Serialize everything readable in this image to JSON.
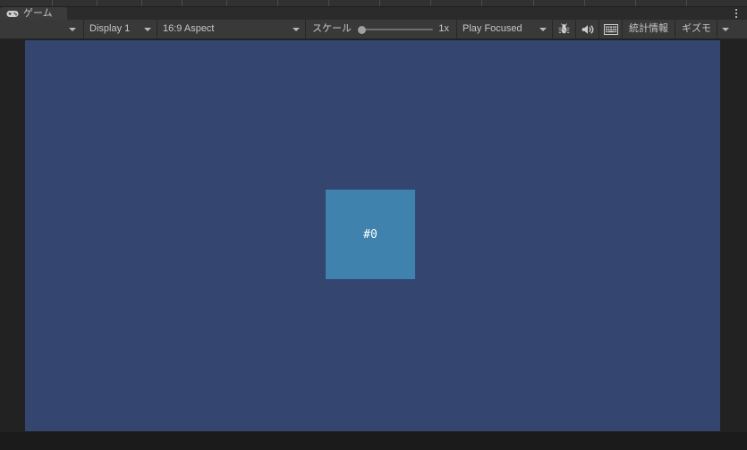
{
  "window": {
    "tab": {
      "label": "ゲーム",
      "icon": "gamepad-icon"
    },
    "menu_icon": "kebab-menu-icon"
  },
  "toolbar": {
    "display_select": {
      "label": "Display 1",
      "caret": "chevron-down-icon"
    },
    "aspect_select": {
      "label": "16:9 Aspect",
      "caret": "chevron-down-icon"
    },
    "scale": {
      "label": "スケール",
      "value": "1x",
      "slider_position_percent": 0
    },
    "play_mode_select": {
      "label": "Play Focused",
      "caret": "chevron-down-icon"
    },
    "buttons": {
      "debug_label": "bug-icon",
      "mute_audio_label": "speaker-icon",
      "device_simulator_label": "grid-icon",
      "stats_label": "統計情報",
      "gizmos_label": "ギズモ",
      "gizmos_caret": "chevron-down-icon"
    }
  },
  "game": {
    "background_color": "#344670",
    "sprite": {
      "label": "#0",
      "color": "#3f82ad"
    }
  }
}
